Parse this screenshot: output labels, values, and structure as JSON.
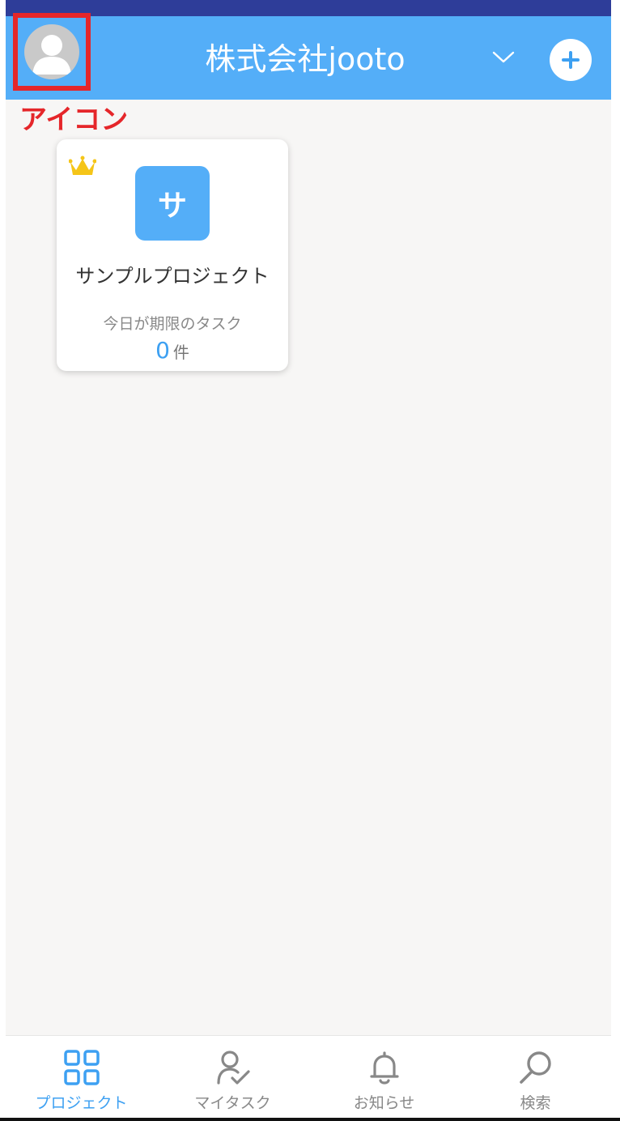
{
  "header": {
    "organization": "株式会社jooto",
    "avatar_annotation": "アイコン",
    "accent_color": "#54aef8",
    "highlight_color": "#e5262a"
  },
  "projects": [
    {
      "badge": "サ",
      "name": "サンプルプロジェクト",
      "due_label": "今日が期限のタスク",
      "due_count": "0",
      "due_unit": "件",
      "owner_icon": "crown-icon"
    }
  ],
  "tabbar": {
    "tabs": [
      {
        "label": "プロジェクト",
        "icon": "grid-icon",
        "active": true
      },
      {
        "label": "マイタスク",
        "icon": "user-check-icon",
        "active": false
      },
      {
        "label": "お知らせ",
        "icon": "bell-icon",
        "active": false
      },
      {
        "label": "検索",
        "icon": "search-icon",
        "active": false
      }
    ]
  }
}
